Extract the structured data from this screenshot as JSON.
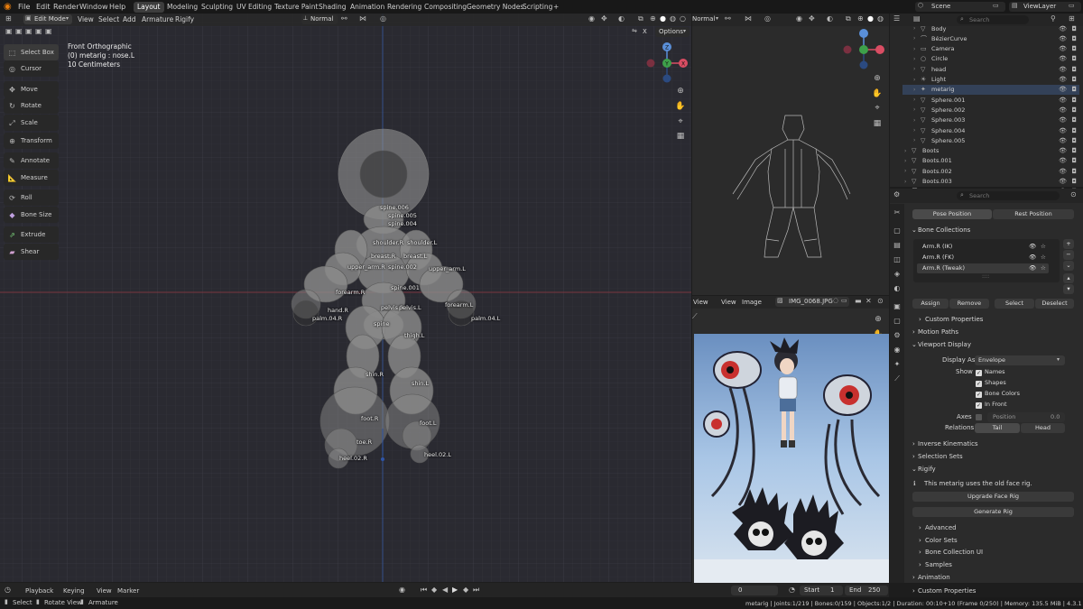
{
  "topbar": {
    "menus": [
      "File",
      "Edit",
      "Render",
      "Window",
      "Help"
    ],
    "workspaces": [
      "Layout",
      "Modeling",
      "Sculpting",
      "UV Editing",
      "Texture Paint",
      "Shading",
      "Animation",
      "Rendering",
      "Compositing",
      "Geometry Nodes",
      "Scripting"
    ],
    "add_tab": "+",
    "scene": "Scene",
    "view_layer": "ViewLayer"
  },
  "viewport": {
    "mode": "Edit Mode",
    "menus": [
      "View",
      "Select",
      "Add",
      "Armature",
      "Rigify"
    ],
    "orientation": "Normal",
    "overlay_info": [
      "Front Orthographic",
      "(0) metarig : nose.L",
      "10 Centimeters"
    ],
    "x_toggle": "X",
    "options": "Options",
    "gizmo": {
      "x": "X",
      "y": "Y",
      "z": "Z"
    }
  },
  "tools": [
    "Select Box",
    "Cursor",
    "Move",
    "Rotate",
    "Scale",
    "Transform",
    "Annotate",
    "Measure",
    "Roll",
    "Bone Size",
    "Extrude",
    "Shear"
  ],
  "bone_labels": [
    "spine.006",
    "spine.005",
    "spine.004",
    "shoulder.R",
    "shoulder.L",
    "breast.R",
    "breast.L",
    "upper_arm.R",
    "spine.002",
    "upper_arm.L",
    "spine.001",
    "forearm.R",
    "forearm.L",
    "hand.R",
    "pelvis.R",
    "pelvis.L",
    "palm.04.R",
    "palm.04.L",
    "spine",
    "thigh.L",
    "shin.R",
    "shin.L",
    "foot.R",
    "foot.L",
    "toe.R",
    "heel.02.R",
    "heel.02.L"
  ],
  "right_viewport": {
    "orientation": "Normal"
  },
  "image_editor": {
    "menus": [
      "View",
      "View",
      "Image"
    ],
    "image_name": "IMG_0068.JPG"
  },
  "outliner": {
    "search_placeholder": "Search",
    "rows": [
      {
        "name": "Body",
        "indent": 1
      },
      {
        "name": "BézierCurve",
        "indent": 1
      },
      {
        "name": "Camera",
        "indent": 1
      },
      {
        "name": "Circle",
        "indent": 1
      },
      {
        "name": "head",
        "indent": 1
      },
      {
        "name": "Light",
        "indent": 1
      },
      {
        "name": "metarig",
        "indent": 1,
        "selected": true
      },
      {
        "name": "Sphere.001",
        "indent": 1
      },
      {
        "name": "Sphere.002",
        "indent": 1
      },
      {
        "name": "Sphere.003",
        "indent": 1
      },
      {
        "name": "Sphere.004",
        "indent": 1
      },
      {
        "name": "Sphere.005",
        "indent": 1
      },
      {
        "name": "Boots",
        "indent": 0
      },
      {
        "name": "Boots.001",
        "indent": 0
      },
      {
        "name": "Boots.002",
        "indent": 0
      },
      {
        "name": "Boots.003",
        "indent": 0
      },
      {
        "name": "BézierCurve.001",
        "indent": 0
      }
    ]
  },
  "properties": {
    "search_placeholder": "Search",
    "pose_position": "Pose Position",
    "rest_position": "Rest Position",
    "bone_collections": "Bone Collections",
    "collections": [
      "Arm.R (IK)",
      "Arm.R (FK)",
      "Arm.R (Tweak)"
    ],
    "assign": "Assign",
    "remove": "Remove",
    "select": "Select",
    "deselect": "Deselect",
    "custom_properties": "Custom Properties",
    "motion_paths": "Motion Paths",
    "viewport_display": "Viewport Display",
    "display_as_label": "Display As",
    "display_as_value": "Envelope",
    "show_label": "Show",
    "show_options": [
      "Names",
      "Shapes",
      "Bone Colors",
      "In Front"
    ],
    "axes_label": "Axes",
    "position_label": "Position",
    "position_value": "0.0",
    "relations_label": "Relations",
    "relations_options": [
      "Tail",
      "Head"
    ],
    "inverse_kinematics": "Inverse Kinematics",
    "selection_sets": "Selection Sets",
    "rigify": "Rigify",
    "rigify_msg": "This metarig uses the old face rig.",
    "upgrade_face_rig": "Upgrade Face Rig",
    "generate_rig": "Generate Rig",
    "rigify_subs": [
      "Advanced",
      "Color Sets",
      "Bone Collection UI",
      "Samples"
    ],
    "animation": "Animation",
    "custom_properties_2": "Custom Properties"
  },
  "timeline": {
    "menus": [
      "Playback",
      "Keying",
      "View",
      "Marker"
    ],
    "current_frame": "0",
    "start_label": "Start",
    "start": "1",
    "end_label": "End",
    "end": "250"
  },
  "statusbar": {
    "select": "Select",
    "rotate_view": "Rotate View",
    "armature": "Armature",
    "info": "metarig | Joints:1/219 | Bones:0/159 | Objects:1/2 | Duration: 00:10+10 (Frame 0/250) | Memory: 135.5 MiB | 4.3.1"
  }
}
